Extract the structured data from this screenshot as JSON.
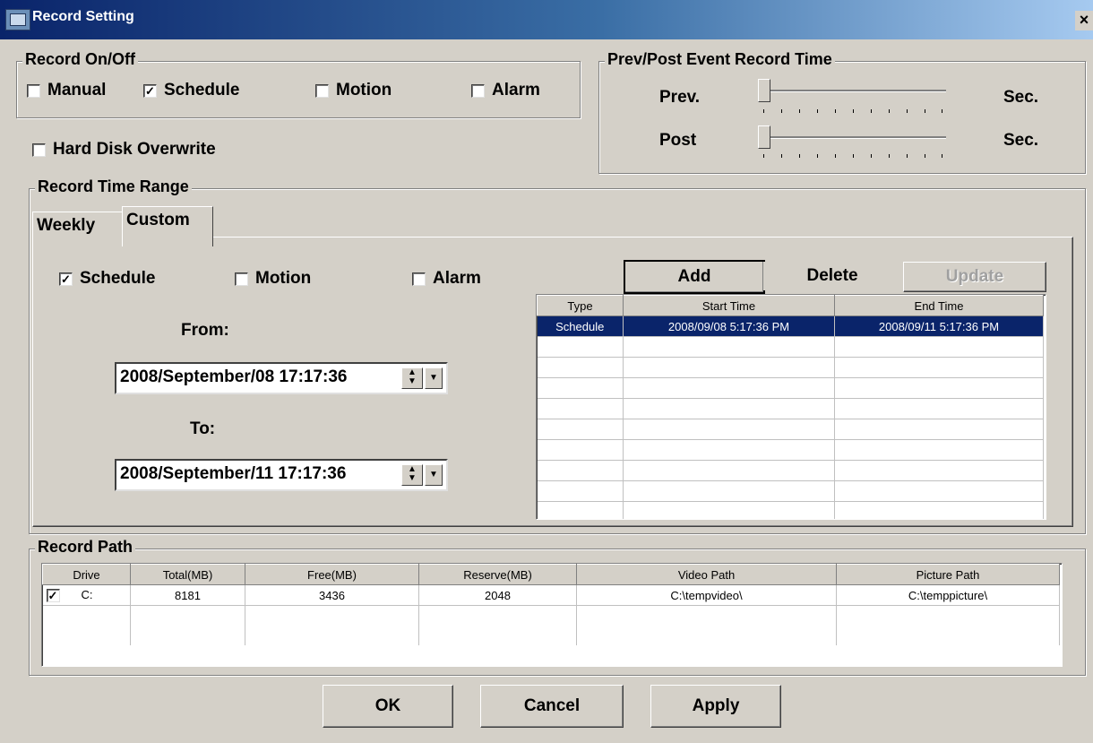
{
  "window": {
    "title": "Record Setting",
    "close": "×"
  },
  "record_onoff": {
    "title": "Record On/Off",
    "manual": {
      "label": "Manual",
      "checked": false
    },
    "schedule": {
      "label": "Schedule",
      "checked": true
    },
    "motion": {
      "label": "Motion",
      "checked": false
    },
    "alarm": {
      "label": "Alarm",
      "checked": false
    }
  },
  "hdd_overwrite": {
    "label": "Hard Disk Overwrite",
    "checked": false
  },
  "prevpost": {
    "title": "Prev/Post Event Record Time",
    "prev_label": "Prev.",
    "post_label": "Post",
    "unit": "Sec.",
    "prev_value": 0,
    "post_value": 0
  },
  "time_range": {
    "title": "Record Time Range",
    "tabs": [
      "Weekly",
      "Custom"
    ],
    "active_tab": "Custom",
    "custom": {
      "schedule": {
        "label": "Schedule",
        "checked": true
      },
      "motion": {
        "label": "Motion",
        "checked": false
      },
      "alarm": {
        "label": "Alarm",
        "checked": false
      },
      "from_label": "From:",
      "to_label": "To:",
      "from_value": "2008/September/08 17:17:36",
      "to_value": "2008/September/11 17:17:36"
    },
    "buttons": {
      "add": "Add",
      "delete": "Delete",
      "update": "Update"
    },
    "table": {
      "columns": [
        "Type",
        "Start Time",
        "End Time"
      ],
      "rows": [
        {
          "type": "Schedule",
          "start": "2008/09/08 5:17:36 PM",
          "end": "2008/09/11 5:17:36 PM",
          "selected": true
        }
      ]
    }
  },
  "record_path": {
    "title": "Record Path",
    "columns": [
      "Drive",
      "Total(MB)",
      "Free(MB)",
      "Reserve(MB)",
      "Video Path",
      "Picture Path"
    ],
    "rows": [
      {
        "checked": true,
        "drive": "C:",
        "total": "8181",
        "free": "3436",
        "reserve": "2048",
        "video": "C:\\tempvideo\\",
        "picture": "C:\\temppicture\\"
      }
    ]
  },
  "footer": {
    "ok": "OK",
    "cancel": "Cancel",
    "apply": "Apply"
  }
}
